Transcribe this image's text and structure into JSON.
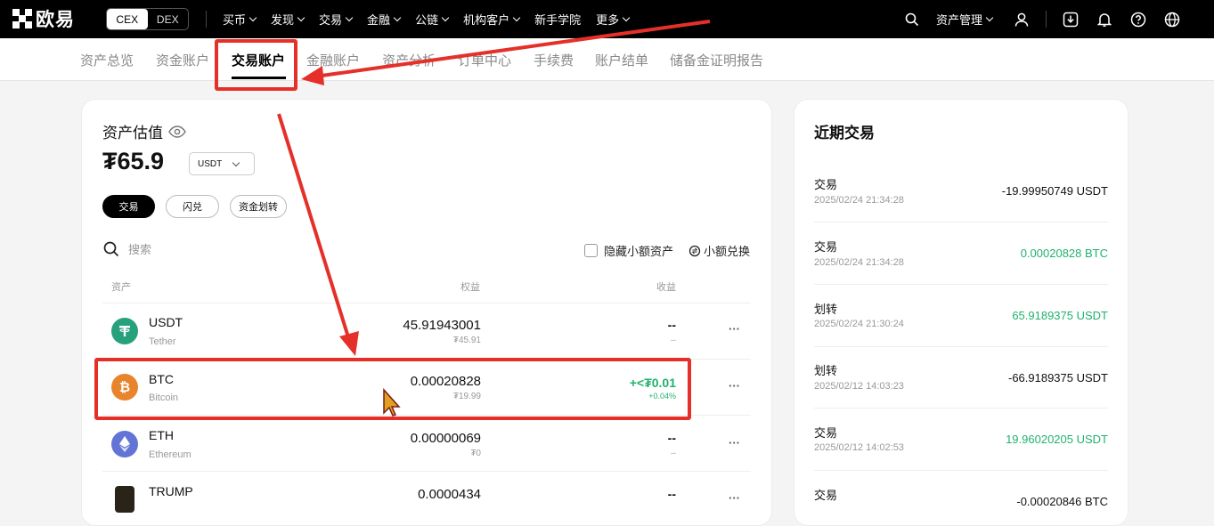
{
  "topnav": {
    "logo": "欧易",
    "mode_switch": [
      "CEX",
      "DEX"
    ],
    "menu": [
      "买币",
      "发现",
      "交易",
      "金融",
      "公链",
      "机构客户",
      "新手学院",
      "更多"
    ],
    "asset_manage": "资产管理"
  },
  "subnav": [
    "资产总览",
    "资金账户",
    "交易账户",
    "金融账户",
    "资产分析",
    "订单中心",
    "手续费",
    "账户结单",
    "储备金证明报告"
  ],
  "asset": {
    "title": "资产估值",
    "balance": "₮65.9",
    "currency": "USDT",
    "buttons": [
      "交易",
      "闪兑",
      "资金划转"
    ],
    "search_placeholder": "搜索",
    "hide_small": "隐藏小额资产",
    "small_convert": "小额兑换",
    "columns": [
      "资产",
      "权益",
      "收益"
    ],
    "rows": [
      {
        "symbol": "USDT",
        "name": "Tether",
        "value": "45.91943001",
        "value_sub": "₮45.91",
        "pl": "--",
        "pl_sub": "--",
        "more": "···",
        "color": "#26a17b",
        "icon": "tether-icon"
      },
      {
        "symbol": "BTC",
        "name": "Bitcoin",
        "value": "0.00020828",
        "value_sub": "₮19.99",
        "pl": "+<₮0.01",
        "pl_sub": "+0.04%",
        "more": "···",
        "color": "#e8842c",
        "icon": "bitcoin-icon"
      },
      {
        "symbol": "ETH",
        "name": "Ethereum",
        "value": "0.00000069",
        "value_sub": "₮0",
        "pl": "--",
        "pl_sub": "--",
        "more": "···",
        "color": "#6275d6",
        "icon": "ethereum-icon"
      },
      {
        "symbol": "TRUMP",
        "name": "",
        "value": "0.0000434",
        "value_sub": "",
        "pl": "--",
        "pl_sub": "",
        "more": "···",
        "color": "#2a2418",
        "icon": "trump-icon"
      }
    ]
  },
  "recent": {
    "title": "近期交易",
    "items": [
      {
        "type": "交易",
        "time": "2025/02/24 21:34:28",
        "amount": "-19.99950749 USDT",
        "positive": false
      },
      {
        "type": "交易",
        "time": "2025/02/24 21:34:28",
        "amount": "0.00020828 BTC",
        "positive": true
      },
      {
        "type": "划转",
        "time": "2025/02/24 21:30:24",
        "amount": "65.9189375 USDT",
        "positive": true
      },
      {
        "type": "划转",
        "time": "2025/02/12 14:03:23",
        "amount": "-66.9189375 USDT",
        "positive": false
      },
      {
        "type": "交易",
        "time": "2025/02/12 14:02:53",
        "amount": "19.96020205 USDT",
        "positive": true
      },
      {
        "type": "交易",
        "time": "",
        "amount": "-0.00020846 BTC",
        "positive": false
      }
    ]
  },
  "colors": {
    "accent": "#000000",
    "positive": "#20b26c",
    "annotation": "#e5302a"
  }
}
